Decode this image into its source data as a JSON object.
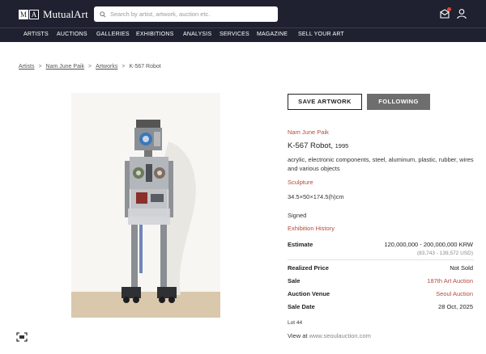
{
  "header": {
    "logo_letters": [
      "M",
      "A"
    ],
    "logo_text": "MutualArt",
    "search_placeholder": "Search by artist, artwork, auction etc.",
    "notification_color": "#e0453a"
  },
  "nav": [
    "ARTISTS",
    "AUCTIONS",
    "GALLERIES",
    "EXHIBITIONS",
    "ANALYSIS",
    "SERVICES",
    "MAGAZINE",
    "SELL YOUR ART"
  ],
  "breadcrumb": {
    "items": [
      "Artists",
      "Nam June Paik",
      "Artworks"
    ],
    "current": "K-567 Robot",
    "separator": ">"
  },
  "actions": {
    "save_label": "SAVE ARTWORK",
    "follow_label": "FOLLOWING"
  },
  "artwork": {
    "artist": "Nam June Paik",
    "title": "K-567 Robot,",
    "year": "1995",
    "medium": "acrylic, electronic components, steel, aluminum, plastic, rubber, wires and various objects",
    "category": "Sculpture",
    "dimensions": "34.5×50×174.5(h)cm",
    "signed": "Signed",
    "exhibition_history": "Exhibition History"
  },
  "sale": {
    "estimate_label": "Estimate",
    "estimate_value": "120,000,000 - 200,000,000 KRW",
    "estimate_usd": "(83,743 - 139,572 USD)",
    "realized_label": "Realized Price",
    "realized_value": "Not Sold",
    "sale_label": "Sale",
    "sale_value": "187th Art Auction",
    "venue_label": "Auction Venue",
    "venue_value": "Seoul Auction",
    "date_label": "Sale Date",
    "date_value": "28 Oct, 2025",
    "lot": "Lot 44",
    "view_prefix": "View at",
    "view_site": "www.seoulauction.com"
  },
  "colors": {
    "header_bg": "#1f2130",
    "accent_red": "#b44a3e",
    "follow_bg": "#6e6e6e"
  }
}
